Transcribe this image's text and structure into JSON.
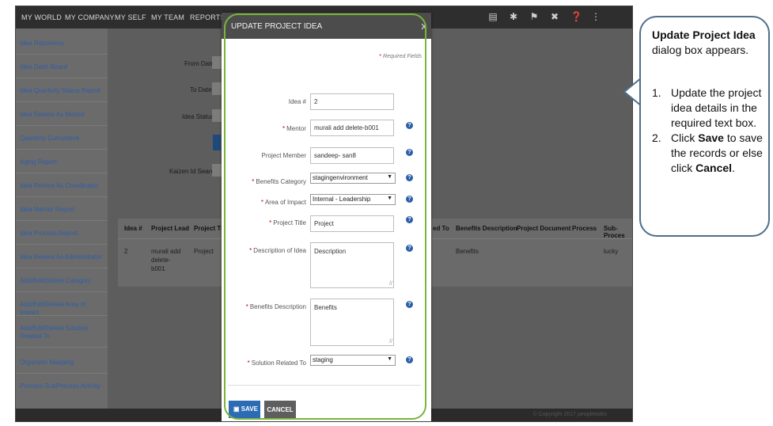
{
  "topnav": {
    "items": [
      "MY WORLD",
      "MY COMPANY",
      "MY SELF",
      "MY TEAM",
      "REPORTS"
    ]
  },
  "sidebar": {
    "items": [
      "Idea Repository",
      "Idea Dash Board",
      "Idea Quarterly Status Report",
      "Idea Review As Mentor",
      "Quarterly Cumulative",
      "Aging Report",
      "Idea Review As Coordinator",
      "Idea Mentor Report",
      "Idea Process Report",
      "Idea Review As Administrator",
      "Add/Edit/Delete Category",
      "Add/Edit/Delete Area of Impact",
      "Add/Edit/Delete Solution Related To",
      "Organizer Mapping",
      "Process-SubProcess Activity"
    ]
  },
  "filters": {
    "from_date": "From Date",
    "to_date": "To Date",
    "idea_status": "Idea Status",
    "kaizen_search": "Kaizen Id Search"
  },
  "table": {
    "headers": [
      "Idea #",
      "Project Lead",
      "Project Titl",
      "ed To",
      "Benefits Description",
      "Project Document",
      "Process",
      "Sub-Proces"
    ],
    "row": {
      "idea_no": "2",
      "lead": "murali add delete-b001",
      "title": "Project",
      "benefits": "Benefits",
      "sub_process": "lucky"
    }
  },
  "footer": {
    "copyright": "© Copyright 2017 peoplewoks"
  },
  "modal": {
    "title": "UPDATE PROJECT IDEA",
    "close": "x",
    "required_note": "Required Fields",
    "labels": {
      "idea_no": "Idea #",
      "mentor": "Mentor",
      "project_member": "Project Member",
      "benefits_category": "Benefits Category",
      "area_of_impact": "Area of Impact",
      "project_title": "Project Title",
      "description": "Description of Idea",
      "benefits_description": "Benefits Description",
      "solution_related_to": "Solution Related To"
    },
    "values": {
      "idea_no": "2",
      "mentor": "murali add delete-b001",
      "project_member": "sandeep- san8",
      "benefits_category": "stagingenvironment",
      "area_of_impact": "Internal - Leadership",
      "project_title": "Project",
      "description": "Description",
      "benefits_description": "Benefits",
      "solution_related_to": "staging"
    },
    "save_label": "SAVE",
    "cancel_label": "CANCEL"
  },
  "callout": {
    "title_bold": "Update Project Idea",
    "title_rest": " dialog  box appears.",
    "steps": [
      {
        "num": "1.",
        "text": "Update the project idea details in the required text box."
      },
      {
        "num": "2.",
        "pre": "Click ",
        "bold1": "Save",
        "mid": " to save the records or else click ",
        "bold2": "Cancel",
        "post": "."
      }
    ]
  },
  "colors": {
    "highlight": "#79b43c",
    "primary_button": "#2c6cb5",
    "required_star": "#cc0000",
    "callout_border": "#4f6f8a"
  }
}
